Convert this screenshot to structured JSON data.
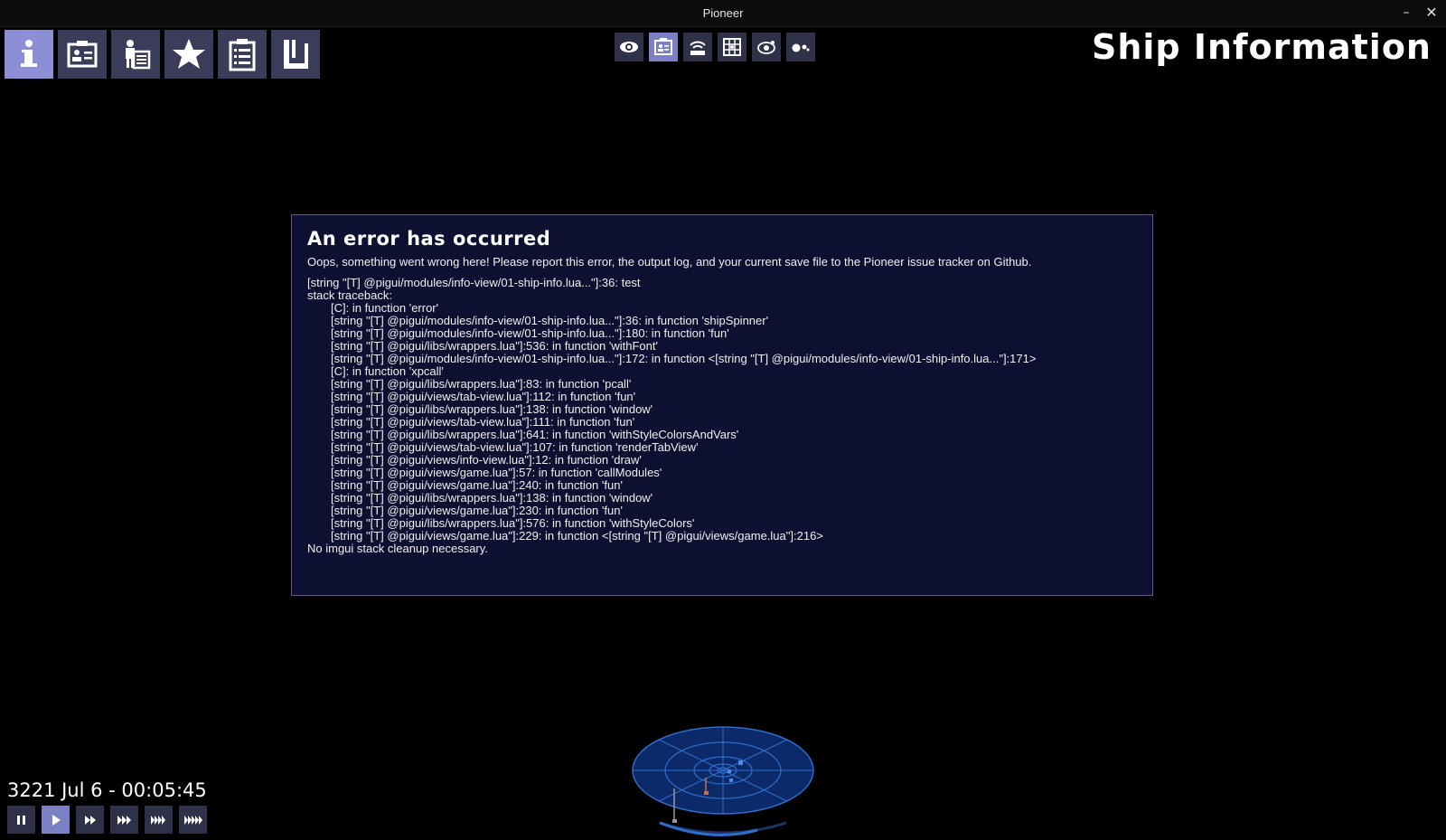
{
  "window": {
    "title": "Pioneer",
    "minimize_glyph": "–",
    "close_glyph": "✕"
  },
  "tabs": [
    {
      "name": "ship-info",
      "icon": "info-icon",
      "active": true
    },
    {
      "name": "personal-info",
      "icon": "id-card-icon",
      "active": false
    },
    {
      "name": "crew-roster",
      "icon": "crew-icon",
      "active": false
    },
    {
      "name": "reputation",
      "icon": "star-icon",
      "active": false
    },
    {
      "name": "missions",
      "icon": "clipboard-icon",
      "active": false
    },
    {
      "name": "econ-trade",
      "icon": "book-icon",
      "active": false
    }
  ],
  "view_buttons": [
    {
      "name": "world-view",
      "icon": "eye-icon",
      "active": false
    },
    {
      "name": "info-view",
      "icon": "id-card-icon",
      "active": true
    },
    {
      "name": "comms",
      "icon": "comms-icon",
      "active": false
    },
    {
      "name": "sector-map",
      "icon": "sector-grid-icon",
      "active": false
    },
    {
      "name": "system-map",
      "icon": "orbit-icon",
      "active": false
    },
    {
      "name": "system-info",
      "icon": "planets-icon",
      "active": false
    }
  ],
  "page_title": "Ship Information",
  "error": {
    "heading": "An error has occurred",
    "message": "Oops, something went wrong here! Please report this error, the output log, and your current save file to the Pioneer issue tracker on Github.",
    "first_line": "[string \"[T] @pigui/modules/info-view/01-ship-info.lua...\"]:36: test",
    "traceback_label": "stack traceback:",
    "traceback": [
      "[C]: in function 'error'",
      "[string \"[T] @pigui/modules/info-view/01-ship-info.lua...\"]:36: in function 'shipSpinner'",
      "[string \"[T] @pigui/modules/info-view/01-ship-info.lua...\"]:180: in function 'fun'",
      "[string \"[T] @pigui/libs/wrappers.lua\"]:536: in function 'withFont'",
      "[string \"[T] @pigui/modules/info-view/01-ship-info.lua...\"]:172: in function <[string \"[T] @pigui/modules/info-view/01-ship-info.lua...\"]:171>",
      "[C]: in function 'xpcall'",
      "[string \"[T] @pigui/libs/wrappers.lua\"]:83: in function 'pcall'",
      "[string \"[T] @pigui/views/tab-view.lua\"]:112: in function 'fun'",
      "[string \"[T] @pigui/libs/wrappers.lua\"]:138: in function 'window'",
      "[string \"[T] @pigui/views/tab-view.lua\"]:111: in function 'fun'",
      "[string \"[T] @pigui/libs/wrappers.lua\"]:641: in function 'withStyleColorsAndVars'",
      "[string \"[T] @pigui/views/tab-view.lua\"]:107: in function 'renderTabView'",
      "[string \"[T] @pigui/views/info-view.lua\"]:12: in function 'draw'",
      "[string \"[T] @pigui/views/game.lua\"]:57: in function 'callModules'",
      "[string \"[T] @pigui/views/game.lua\"]:240: in function 'fun'",
      "[string \"[T] @pigui/libs/wrappers.lua\"]:138: in function 'window'",
      "[string \"[T] @pigui/views/game.lua\"]:230: in function 'fun'",
      "[string \"[T] @pigui/libs/wrappers.lua\"]:576: in function 'withStyleColors'",
      "[string \"[T] @pigui/views/game.lua\"]:229: in function <[string \"[T] @pigui/views/game.lua\"]:216>"
    ],
    "footer": "No imgui stack cleanup necessary."
  },
  "game_date": "3221 Jul 6 - 00:05:45",
  "time_controls": [
    {
      "name": "pause",
      "icon": "pause-icon",
      "active": false
    },
    {
      "name": "play",
      "icon": "play-icon",
      "active": true
    },
    {
      "name": "speed-2",
      "icon": "fast-forward-2-icon",
      "active": false
    },
    {
      "name": "speed-3",
      "icon": "fast-forward-3-icon",
      "active": false
    },
    {
      "name": "speed-4",
      "icon": "fast-forward-4-icon",
      "active": false
    },
    {
      "name": "speed-5",
      "icon": "fast-forward-5-icon",
      "active": false
    }
  ],
  "colors": {
    "accent_active": "#8b8fd6",
    "button_bg": "#3a3c5a",
    "dialog_bg": "#0d1030",
    "radar_blue": "#2f6ec8"
  }
}
